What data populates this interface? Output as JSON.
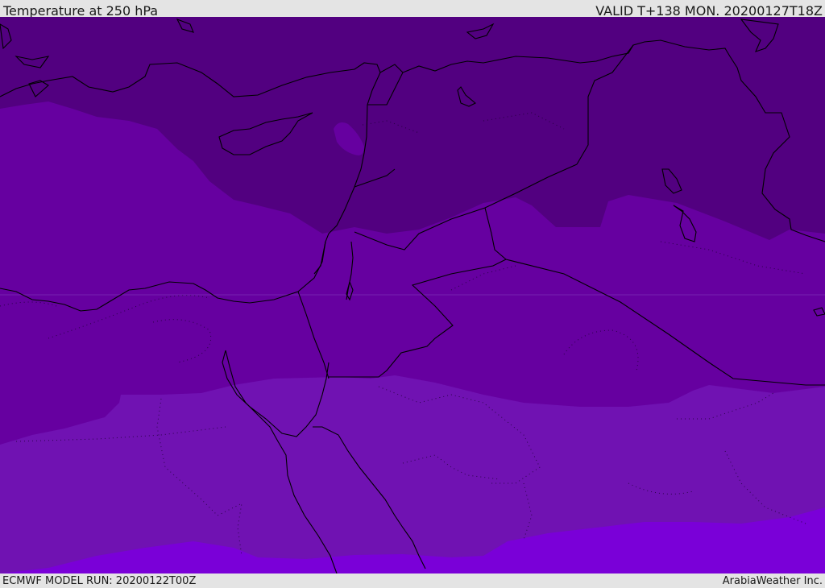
{
  "header": {
    "title": "Temperature at 250 hPa",
    "valid": "VALID T+138 MON. 20200127T18Z"
  },
  "footer": {
    "model_run": "ECMWF MODEL RUN: 20200122T00Z",
    "credit": "ArabiaWeather Inc."
  },
  "map": {
    "field": "temperature",
    "pressure_level": "250 hPa",
    "band_colors": [
      "#520080",
      "#5c0090",
      "#6600a0",
      "#7012b2",
      "#7a00d8"
    ]
  }
}
